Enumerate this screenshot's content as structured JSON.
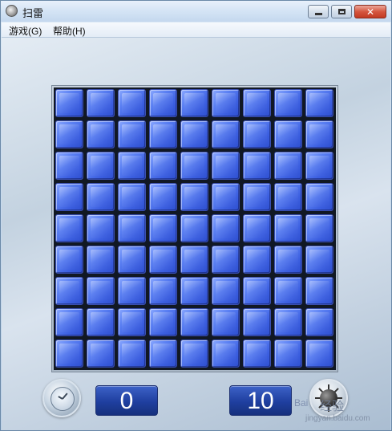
{
  "window": {
    "title": "扫雷",
    "icon": "minesweeper-app-icon",
    "controls": {
      "minimize": "minimize-icon",
      "maximize": "maximize-icon",
      "close": "close-icon"
    }
  },
  "menu": {
    "items": [
      {
        "label": "游戏(G)"
      },
      {
        "label": "帮助(H)"
      }
    ]
  },
  "board": {
    "rows": 9,
    "cols": 9,
    "state": "all-covered",
    "tile_color": "#4a6ce8"
  },
  "status": {
    "time": "0",
    "mines": "10",
    "time_icon": "clock-icon",
    "mines_icon": "mine-icon"
  },
  "watermark": {
    "logo": "Bai",
    "text": "经验",
    "url": "jingyan.baidu.com"
  }
}
